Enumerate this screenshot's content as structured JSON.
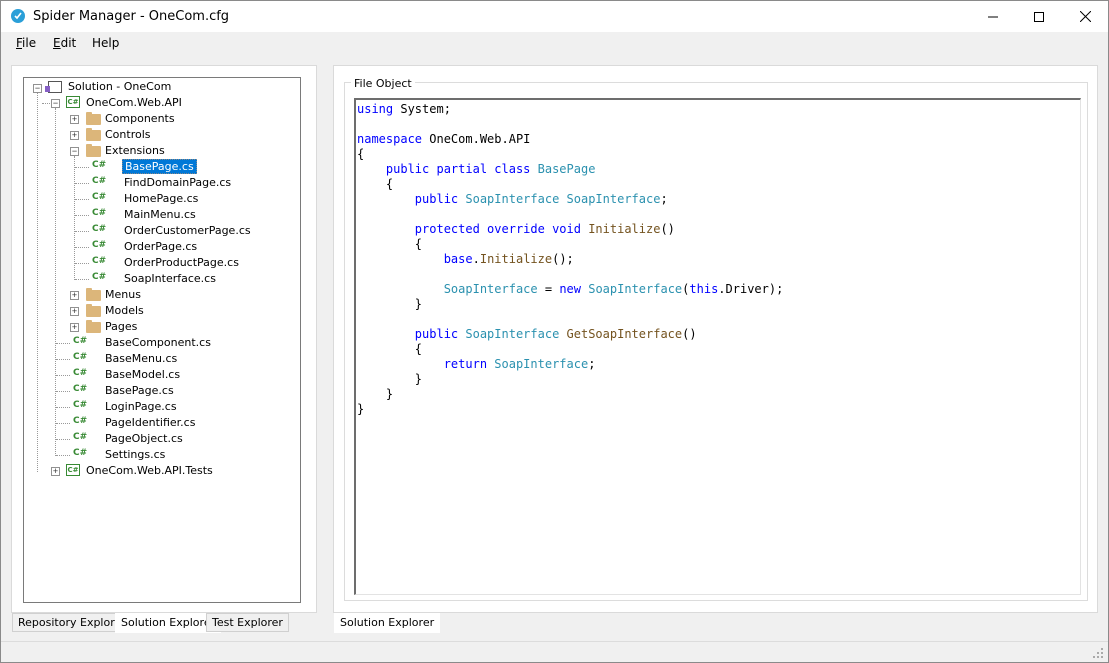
{
  "window": {
    "title": "Spider Manager - OneCom.cfg",
    "controls": {
      "minimize": "minimize",
      "maximize": "maximize",
      "close": "close"
    }
  },
  "menu": [
    {
      "underline": "F",
      "rest": "ile"
    },
    {
      "underline": "E",
      "rest": "dit"
    },
    {
      "underline": "",
      "rest": "Help"
    }
  ],
  "tree": {
    "solution": "Solution - OneCom",
    "project": "OneCom.Web.API",
    "folders_top": [
      "Components",
      "Controls",
      "Extensions"
    ],
    "extension_files": [
      "BasePage.cs",
      "FindDomainPage.cs",
      "HomePage.cs",
      "MainMenu.cs",
      "OrderCustomerPage.cs",
      "OrderPage.cs",
      "OrderProductPage.cs",
      "SoapInterface.cs"
    ],
    "selected": "BasePage.cs",
    "folders_bottom": [
      "Menus",
      "Models",
      "Pages"
    ],
    "root_files": [
      "BaseComponent.cs",
      "BaseMenu.cs",
      "BaseModel.cs",
      "BasePage.cs",
      "LoginPage.cs",
      "PageIdentifier.cs",
      "PageObject.cs",
      "Settings.cs"
    ],
    "project2": "OneCom.Web.API.Tests"
  },
  "left_tabs": [
    "Repository Explorer",
    "Solution Explorer",
    "Test Explorer"
  ],
  "left_active_tab": "Solution Explorer",
  "right_panel": {
    "group_title": "File Object",
    "tab": "Solution Explorer"
  },
  "code_lines": [
    [
      [
        "kw",
        "using"
      ],
      [
        "",
        "System;"
      ]
    ],
    [],
    [
      [
        "kw",
        "namespace"
      ],
      [
        "",
        "OneCom.Web.API"
      ]
    ],
    [
      [
        "",
        "{"
      ]
    ],
    [
      [
        "",
        "    "
      ],
      [
        "kw",
        "public partial class"
      ],
      [
        "ty",
        "BasePage"
      ]
    ],
    [
      [
        "",
        "    {"
      ]
    ],
    [
      [
        "",
        "        "
      ],
      [
        "kw",
        "public"
      ],
      [
        "ty",
        "SoapInterface"
      ],
      [
        "ty",
        "SoapInterface"
      ],
      [
        "",
        ";"
      ]
    ],
    [],
    [
      [
        "",
        "        "
      ],
      [
        "kw",
        "protected override void"
      ],
      [
        "fn",
        "Initialize"
      ],
      [
        "",
        "()"
      ]
    ],
    [
      [
        "",
        "        {"
      ]
    ],
    [
      [
        "",
        "            "
      ],
      [
        "kw",
        "base"
      ],
      [
        "",
        "."
      ],
      [
        "fn",
        "Initialize"
      ],
      [
        "",
        "();"
      ]
    ],
    [],
    [
      [
        "",
        "            "
      ],
      [
        "ty",
        "SoapInterface"
      ],
      [
        "",
        ""
      ],
      [
        "",
        "= "
      ],
      [
        "kw",
        "new"
      ],
      [
        "ty",
        "SoapInterface"
      ],
      [
        "",
        "("
      ],
      [
        "kw",
        "this"
      ],
      [
        "",
        ".Driver);"
      ]
    ],
    [
      [
        "",
        "        }"
      ]
    ],
    [],
    [
      [
        "",
        "        "
      ],
      [
        "kw",
        "public"
      ],
      [
        "ty",
        "SoapInterface"
      ],
      [
        "fn",
        "GetSoapInterface"
      ],
      [
        "",
        "()"
      ]
    ],
    [
      [
        "",
        "        {"
      ]
    ],
    [
      [
        "",
        "            "
      ],
      [
        "kw",
        "return"
      ],
      [
        "ty",
        "SoapInterface"
      ],
      [
        "",
        ";"
      ]
    ],
    [
      [
        "",
        "        }"
      ]
    ],
    [
      [
        "",
        "    }"
      ]
    ],
    [
      [
        "",
        "}"
      ]
    ]
  ]
}
